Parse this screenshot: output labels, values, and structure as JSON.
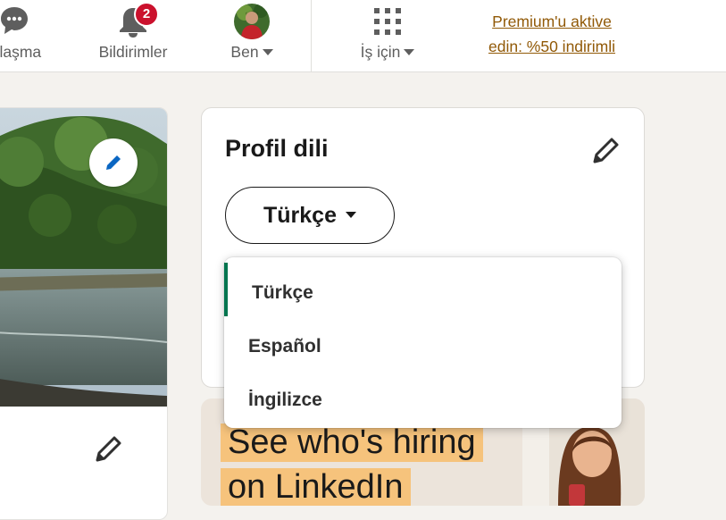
{
  "nav": {
    "messaging_label": "ajlaşma",
    "notifications_label": "Bildirimler",
    "notifications_badge": "2",
    "me_label": "Ben",
    "business_label": "İş için",
    "premium_line1": "Premium'u aktive",
    "premium_line2": "edin: %50 indirimli"
  },
  "language_card": {
    "title": "Profil dili",
    "selected_language": "Türkçe"
  },
  "language_dropdown": {
    "options": [
      "Türkçe",
      "Español",
      "İngilizce"
    ],
    "active_index": 0
  },
  "ad": {
    "line1": "See who's hiring",
    "line2": "on LinkedIn"
  },
  "colors": {
    "premium_link": "#915907",
    "badge": "#cb112d",
    "active_option_bar": "#01754f",
    "ad_highlight": "#f6c37c"
  }
}
